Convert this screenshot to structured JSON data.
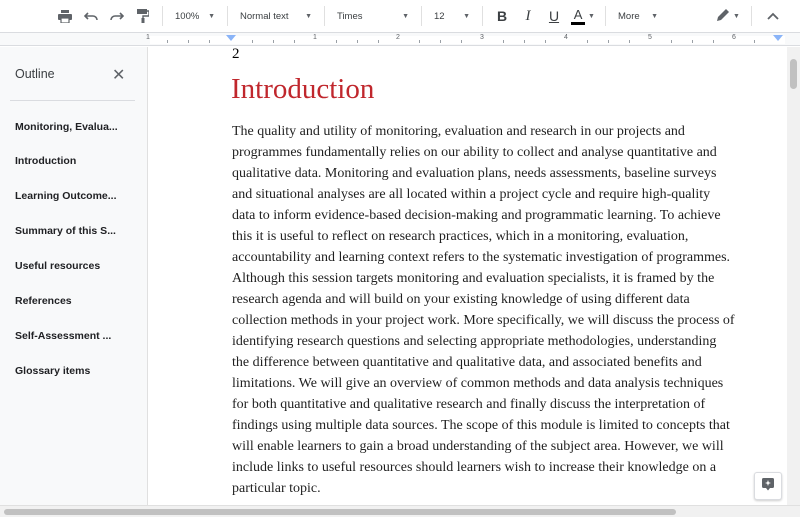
{
  "toolbar": {
    "zoom": "100%",
    "style": "Normal text",
    "font": "Times",
    "size": "12",
    "bold": "B",
    "italic": "I",
    "underline": "U",
    "text_color": "A",
    "more": "More",
    "icons": [
      "print-icon",
      "undo-icon",
      "redo-icon",
      "paint-format-icon",
      "edit-mode-icon",
      "collapse-icon"
    ]
  },
  "ruler": {
    "numbers": [
      "1",
      "1",
      "2",
      "3",
      "4",
      "5",
      "6"
    ]
  },
  "outline": {
    "title": "Outline",
    "items": [
      "Monitoring, Evalua...",
      "Introduction",
      "Learning Outcome...",
      "Summary of this S...",
      "Useful resources",
      "References",
      "Self-Assessment ...",
      "Glossary items"
    ]
  },
  "document": {
    "page_number": "2",
    "heading": "Introduction",
    "heading_color": "#c0272d",
    "lines": [
      "The quality and utility of monitoring, evaluation and research in our projects and",
      "programmes fundamentally relies on our ability to collect and analyse quantitative and",
      "qualitative data. Monitoring and evaluation plans, needs assessments, baseline surveys",
      "and situational analyses are all located within a project cycle and require high-quality",
      "data to inform evidence-based decision-making and programmatic learning. To achieve",
      "this it is useful to reflect on research practices, which in a monitoring, evaluation,",
      "accountability and learning context refers to the systematic investigation of programmes.",
      "Although this session targets monitoring and evaluation specialists, it is framed by the",
      "research agenda and will build on your existing knowledge of using different data",
      "collection methods in your project work. More specifically, we will discuss the process of",
      "identifying research questions and selecting appropriate methodologies, understanding",
      "the difference between quantitative and qualitative data, and associated benefits and",
      "limitations. We will give an overview of common methods and data analysis techniques",
      "for both quantitative and qualitative research and finally discuss the interpretation of",
      "findings using multiple data sources. The scope of this module is limited to concepts that",
      "will enable learners to gain a broad understanding of the subject area. However, we will",
      "include links to useful resources should learners wish to increase their knowledge on a",
      "particular topic."
    ]
  }
}
